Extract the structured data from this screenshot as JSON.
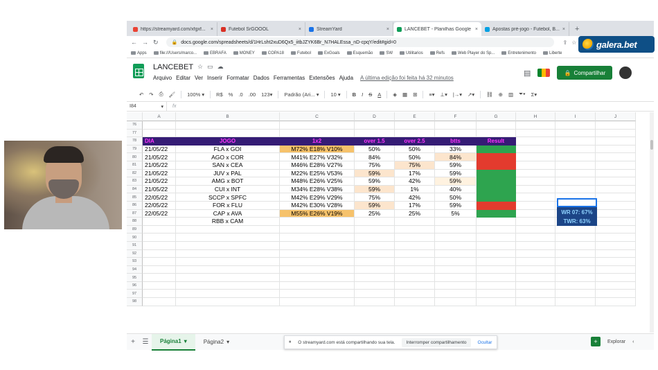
{
  "browser": {
    "tabs": [
      {
        "label": "https://streamyard.com/xfgxf...",
        "fav_color": "#ea4335",
        "active": false
      },
      {
        "label": "Futebol SrGOOOL",
        "fav_color": "#d93025",
        "active": false
      },
      {
        "label": "StreamYard",
        "fav_color": "#1a73e8",
        "active": false
      },
      {
        "label": "LANCEBET - Planilhas Google",
        "fav_color": "#0f9d58",
        "active": true
      },
      {
        "label": "Apostas pré-jogo - Futebol, B...",
        "fav_color": "#00a0e3",
        "active": false
      }
    ],
    "address": "docs.google.com/spreadsheets/d/1HrLsht2xuD6Qx5_iitbJZYK6Br_N7HALEssa_nD-cpqY/edit#gid=0",
    "bookmarks": [
      "Apps",
      "file:///Users/marco...",
      "EBRAFA",
      "MONEY",
      "COPA18",
      "Futebol",
      "ExGoals",
      "Esquemão",
      "SW",
      "Utilitarios",
      "Refs",
      "Web Player do Sp...",
      "Entretenimento",
      "Liberte"
    ]
  },
  "overlay": {
    "brand": "galera.bet"
  },
  "sheets": {
    "title": "LANCEBET",
    "menu": [
      "Arquivo",
      "Editar",
      "Ver",
      "Inserir",
      "Formatar",
      "Dados",
      "Ferramentas",
      "Extensões",
      "Ajuda"
    ],
    "last_edit": "A última edição foi feita há 32 minutos",
    "share_label": "Compartilhar",
    "toolbar": {
      "zoom": "100%",
      "currency": "R$",
      "percent": "%",
      "dec_less": ".0",
      "dec_more": ".00",
      "format": "123",
      "font": "Padrão (Ari...",
      "size": "10"
    },
    "namebox": "I84",
    "fx": "fx"
  },
  "grid": {
    "columns": [
      "A",
      "B",
      "C",
      "D",
      "E",
      "F",
      "G",
      "H",
      "I",
      "J"
    ],
    "header_row": {
      "num": "78",
      "cells": [
        "DIA",
        "JOGO",
        "1x2",
        "over 1.5",
        "over 2.5",
        "btts",
        "Result"
      ]
    },
    "rows": [
      {
        "num": "79",
        "dia": "21/05/22",
        "jogo": "FLA x GOI",
        "x12": "M72% E18% V10%",
        "o15": "50%",
        "o25": "50%",
        "btts": "33%",
        "result": "green"
      },
      {
        "num": "80",
        "dia": "21/05/22",
        "jogo": "AGO x COR",
        "x12": "M41% E27% V32%",
        "o15": "84%",
        "o25": "50%",
        "btts": "84%",
        "result": "red"
      },
      {
        "num": "81",
        "dia": "21/05/22",
        "jogo": "SAN x CEA",
        "x12": "M46% E28% V27%",
        "o15": "75%",
        "o25": "75%",
        "btts": "59%",
        "result": "red"
      },
      {
        "num": "82",
        "dia": "21/05/22",
        "jogo": "JUV x PAL",
        "x12": "M22% E25% V53%",
        "o15": "59%",
        "o25": "17%",
        "btts": "59%",
        "result": "green"
      },
      {
        "num": "83",
        "dia": "21/05/22",
        "jogo": "AMG x BOT",
        "x12": "M48% E26% V25%",
        "o15": "59%",
        "o25": "42%",
        "btts": "59%",
        "result": "green"
      },
      {
        "num": "84",
        "dia": "21/05/22",
        "jogo": "CUI x INT",
        "x12": "M34% E28% V38%",
        "o15": "59%",
        "o25": "1%",
        "btts": "40%",
        "result": "green"
      },
      {
        "num": "85",
        "dia": "22/05/22",
        "jogo": "SCCP x SPFC",
        "x12": "M42% E29% V29%",
        "o15": "75%",
        "o25": "42%",
        "btts": "50%",
        "result": "green"
      },
      {
        "num": "86",
        "dia": "22/05/22",
        "jogo": "FOR x FLU",
        "x12": "M42% E30% V28%",
        "o15": "59%",
        "o25": "17%",
        "btts": "59%",
        "result": "red"
      },
      {
        "num": "87",
        "dia": "22/05/22",
        "jogo": "CAP x AVA",
        "x12": "M55% E26% V19%",
        "o15": "25%",
        "o25": "25%",
        "btts": "5%",
        "result": "green"
      },
      {
        "num": "88",
        "dia": "",
        "jogo": "RBB x CAM",
        "x12": "",
        "o15": "",
        "o25": "",
        "btts": "",
        "result": ""
      }
    ],
    "top_rows": [
      "76",
      "77"
    ],
    "empty_rows": [
      "89",
      "90",
      "91",
      "92",
      "93",
      "94",
      "95",
      "96",
      "97",
      "98"
    ],
    "stats": {
      "wr": "WR 07: 67%",
      "twr": "TWR: 63%"
    }
  },
  "bottom": {
    "sheets": [
      "Página1",
      "Página2"
    ],
    "share_notice": "O streamyard.com está compartilhando sua tela.",
    "stop_label": "Interromper compartilhamento",
    "hide_label": "Ocultar",
    "explore_label": "Explorar"
  },
  "colors": {
    "header_bg": "#351c75",
    "header_text": "#ff33ff",
    "green": "#2ea44f",
    "red": "#e33b2e",
    "orange": "#f6c26b"
  }
}
